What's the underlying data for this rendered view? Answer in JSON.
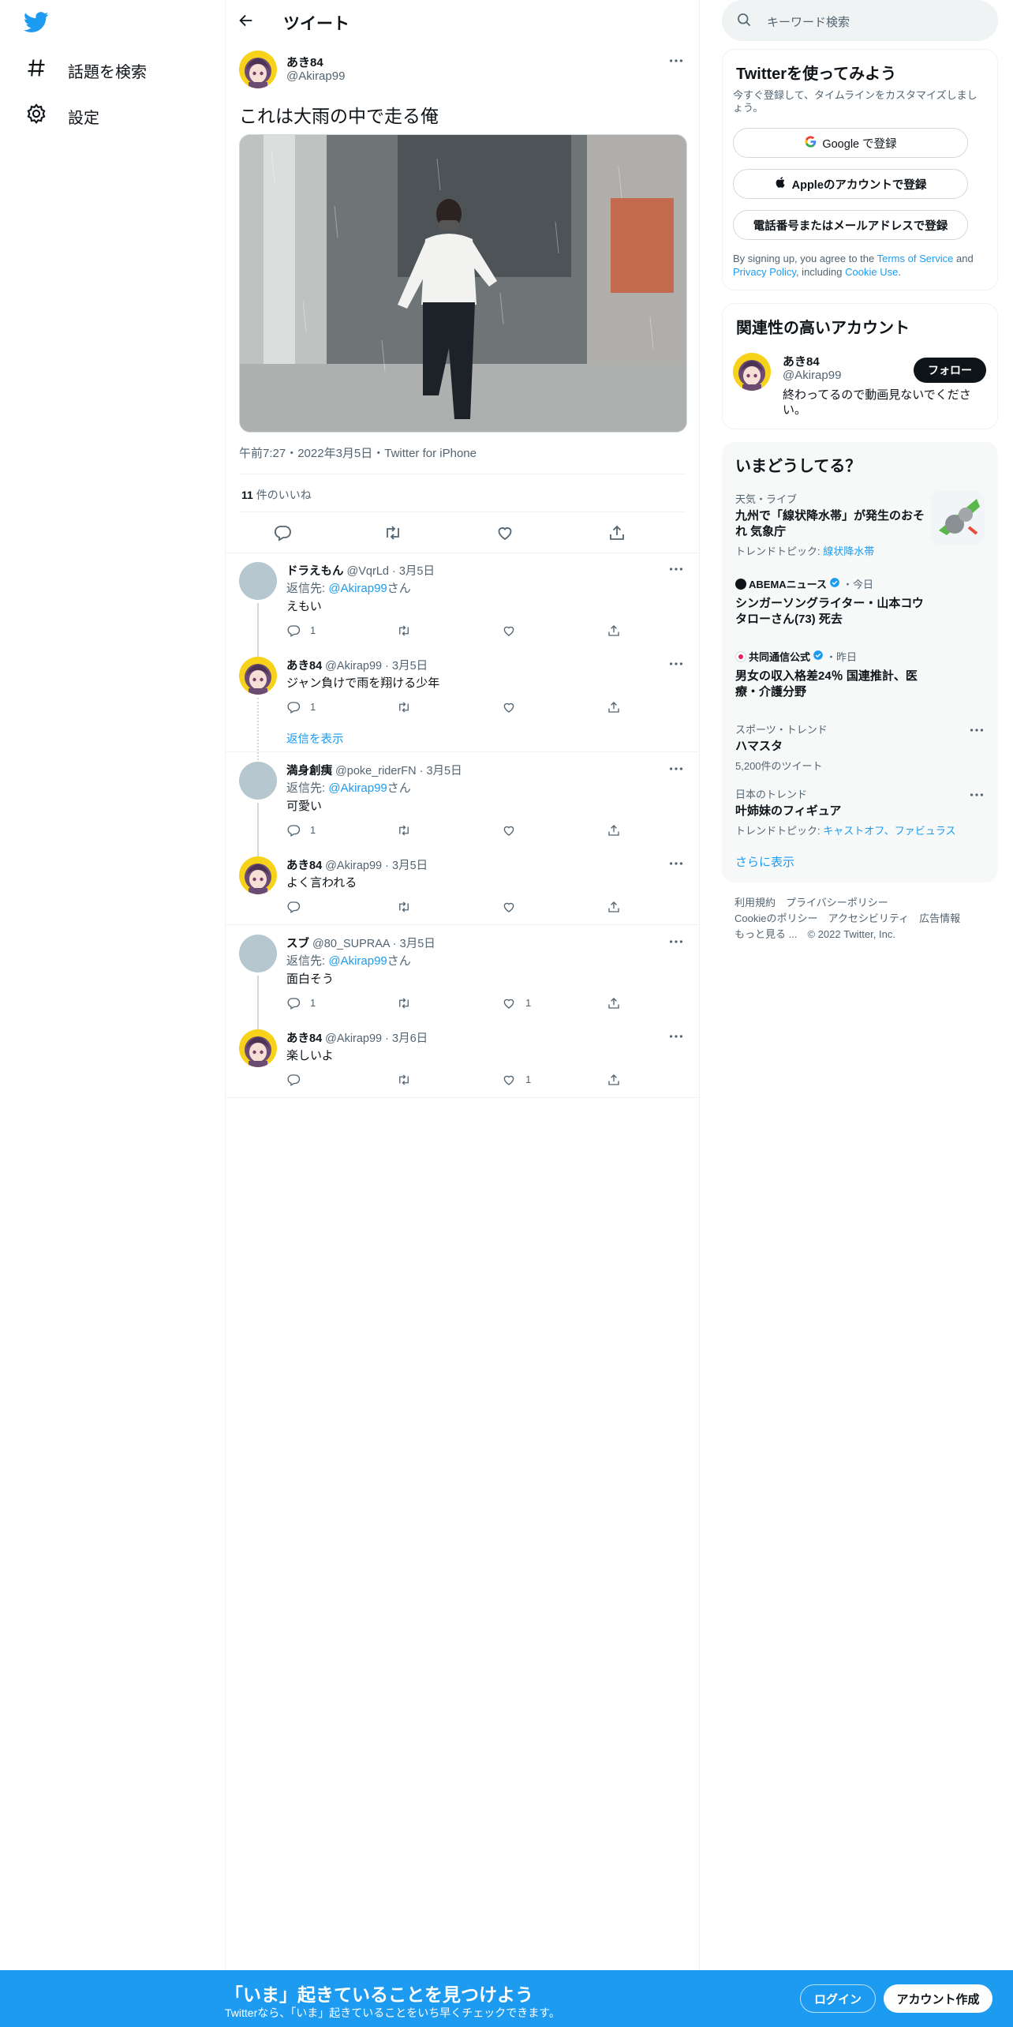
{
  "nav": {
    "items": [
      {
        "label": "話題を検索",
        "icon": "hashtag-icon"
      },
      {
        "label": "設定",
        "icon": "gear-icon"
      }
    ]
  },
  "header": {
    "title": "ツイート"
  },
  "tweet": {
    "name": "あき84",
    "handle": "@Akirap99",
    "text": "これは大雨の中で走る俺",
    "meta": "午前7:27・2022年3月5日・Twitter for iPhone",
    "likes_count": "11",
    "likes_label": " 件のいいね"
  },
  "replies": [
    {
      "name": "ドラえもん",
      "handle_time": "@VqrLd · 3月5日",
      "reply_to_prefix": "返信先: ",
      "reply_to": "@Akirap99",
      "reply_to_suffix": "さん",
      "text": "えもい",
      "reply_count": "1",
      "like_count": ""
    },
    {
      "name": "あき84",
      "handle_time": "@Akirap99 · 3月5日",
      "text": "ジャン負けで雨を翔ける少年",
      "reply_count": "1",
      "like_count": ""
    },
    {
      "name": "満身創痍",
      "handle_time": "@poke_riderFN · 3月5日",
      "reply_to_prefix": "返信先: ",
      "reply_to": "@Akirap99",
      "reply_to_suffix": "さん",
      "text": "可愛い",
      "reply_count": "1",
      "like_count": ""
    },
    {
      "name": "あき84",
      "handle_time": "@Akirap99 · 3月5日",
      "text": "よく言われる",
      "reply_count": "",
      "like_count": ""
    },
    {
      "name": "スブ",
      "handle_time": "@80_SUPRAA · 3月5日",
      "reply_to_prefix": "返信先: ",
      "reply_to": "@Akirap99",
      "reply_to_suffix": "さん",
      "text": "面白そう",
      "reply_count": "1",
      "like_count": "1"
    },
    {
      "name": "あき84",
      "handle_time": "@Akirap99 · 3月6日",
      "text": "楽しいよ",
      "reply_count": "",
      "like_count": "1"
    }
  ],
  "show_replies": "返信を表示",
  "search": {
    "placeholder": "キーワード検索"
  },
  "signup_card": {
    "title": "Twitterを使ってみよう",
    "subtitle": "今すぐ登録して、タイムラインをカスタマイズしましょう。",
    "google": "Google で登録",
    "apple": "Appleのアカウントで登録",
    "phone": "電話番号またはメールアドレスで登録",
    "legal_1": "By signing up, you agree to the ",
    "tos": "Terms of Service",
    "legal_2": " and ",
    "privacy": "Privacy Policy",
    "legal_3": ", including ",
    "cookie": "Cookie Use",
    "legal_4": "."
  },
  "relevant": {
    "title": "関連性の高いアカウント",
    "name": "あき84",
    "handle": "@Akirap99",
    "bio": "終わってるので動画見ないでください。",
    "follow": "フォロー"
  },
  "trends": {
    "title": "いまどうしてる？",
    "items": [
      {
        "category": "天気・ライブ",
        "title": "九州で「線状降水帯」が発生のおそれ 気象庁",
        "sub_prefix": "トレンドトピック: ",
        "sub_link": "線状降水帯"
      },
      {
        "source": "ABEMAニュース",
        "time": "・今日",
        "title": "シンガーソングライター・山本コウタローさん(73) 死去"
      },
      {
        "source": "共同通信公式",
        "time": "・昨日",
        "title": "男女の収入格差24％ 国連推計、医療・介護分野"
      },
      {
        "category": "スポーツ・トレンド",
        "title": "ハマスタ",
        "sub": "5,200件のツイート"
      },
      {
        "category": "日本のトレンド",
        "title": "叶姉妹のフィギュア",
        "sub_prefix": "トレンドトピック: ",
        "sub_link": "キャストオフ、ファビュラス"
      }
    ],
    "more": "さらに表示"
  },
  "footer": {
    "terms": "利用規約",
    "privacy": "プライバシーポリシー",
    "cookie": "Cookieのポリシー",
    "accessibility": "アクセシビリティ",
    "ads": "広告情報",
    "more": "もっと見る ...",
    "copyright": "© 2022 Twitter, Inc."
  },
  "bottombar": {
    "headline": "「いま」起きていることを見つけよう",
    "sub": "Twitterなら、「いま」起きていることをいち早くチェックできます。",
    "login": "ログイン",
    "signup": "アカウント作成"
  },
  "colors": {
    "accent": "#1d9bf0",
    "text": "#0f1419",
    "muted": "#536471",
    "border": "#eff3f4"
  }
}
